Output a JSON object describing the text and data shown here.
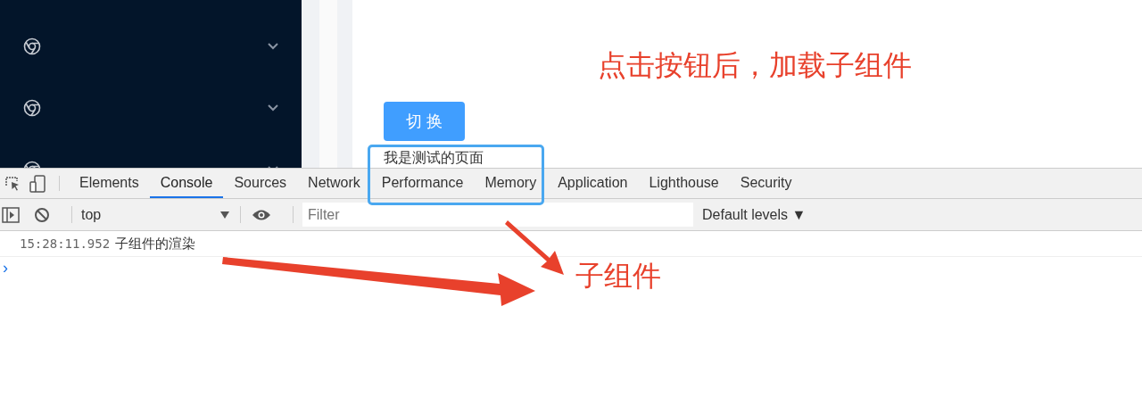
{
  "sidebar": {
    "items": [
      {
        "expanded": false
      },
      {
        "expanded": false
      },
      {
        "expanded": false
      }
    ]
  },
  "page": {
    "heading": "点击按钮后，加载子组件",
    "button": "切 换",
    "child_text": "我是测试的页面"
  },
  "devtools": {
    "tabs": [
      {
        "label": "Elements",
        "selected": false
      },
      {
        "label": "Console",
        "selected": true
      },
      {
        "label": "Sources",
        "selected": false
      },
      {
        "label": "Network",
        "selected": false
      },
      {
        "label": "Performance",
        "selected": false
      },
      {
        "label": "Memory",
        "selected": false
      },
      {
        "label": "Application",
        "selected": false
      },
      {
        "label": "Lighthouse",
        "selected": false
      },
      {
        "label": "Security",
        "selected": false
      }
    ],
    "context": "top",
    "filter_placeholder": "Filter",
    "levels": "Default levels ▼",
    "messages": [
      {
        "time": "15:28:11.952",
        "text": "子组件的渲染"
      }
    ],
    "prompt": "›"
  },
  "annotation": {
    "label": "子组件"
  }
}
